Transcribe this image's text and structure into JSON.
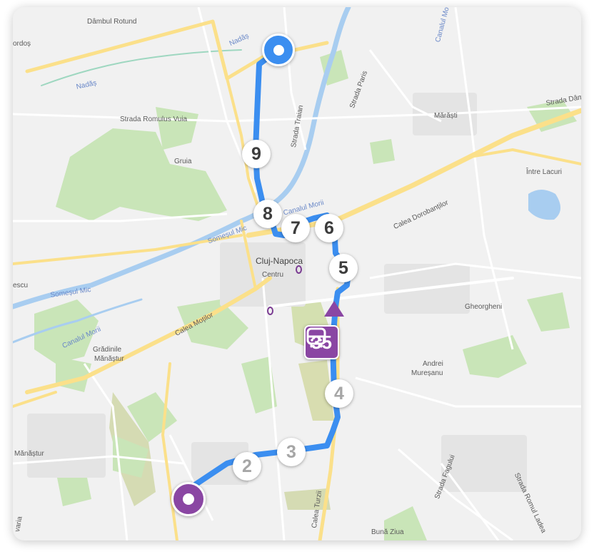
{
  "colors": {
    "route": "#3b8ef0",
    "bus": "#8a46a3",
    "road_major": "#fbe08a",
    "park": "#c5e3b4",
    "water": "#a8cdf0"
  },
  "labels": {
    "dambul_rotund": "Dâmbul Rotund",
    "nadas_1": "Nadăș",
    "nadas_2": "Nadăș",
    "fordos": "ordoș",
    "canalul_top": "Canalul Mo",
    "strada_paris": "Strada Paris",
    "strada_traian": "Strada Traian",
    "strada_dambu": "Strada Dâmb",
    "marasti": "Mărăști",
    "romulus": "Strada Romulus Vuia",
    "gruia": "Gruia",
    "intre_lacuri": "Între Lacuri",
    "somesul_mic_1": "Someșul Mic",
    "somesul_mic_2": "Someșul Mic",
    "canalul_morii_1": "Canalul Morii",
    "canalul_morii_2": "Canalul Morii",
    "calea_dorobantilor": "Calea Dorobanților",
    "cluj": "Cluj-Napoca",
    "centru": "Centru",
    "escu": "escu",
    "gheorgheni": "Gheorgheni",
    "calea_motilor": "Calea Moților",
    "gradinile_1": "Grădinile",
    "gradinile_2": "Mănăștur",
    "andrei_1": "Andrei",
    "andrei_2": "Mureșanu",
    "manastur": "Mănăștur",
    "strada_fagului": "Strada Fagului",
    "strada_romul": "Strada Romul Ladea",
    "calea_turzii": "Calea Turzii",
    "buna_ziua": "Bună Ziua",
    "varia": "varia"
  },
  "route": {
    "origin": "origin-marker",
    "destination": "destination-marker",
    "bus_icon": "bus-icon",
    "bus_line": "35",
    "stops_passed": [
      "9",
      "8",
      "7",
      "6",
      "5"
    ],
    "stops_upcoming": [
      "4",
      "3",
      "2"
    ]
  }
}
